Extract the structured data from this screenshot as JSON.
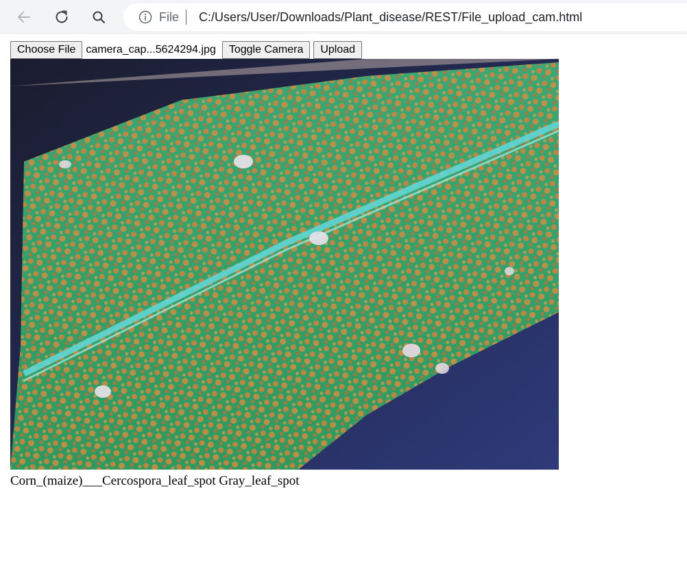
{
  "browser": {
    "icons": {
      "back": "arrow-left-icon",
      "reload": "reload-icon",
      "search": "search-icon",
      "info": "info-icon"
    },
    "address_bar": {
      "scheme_label": "File",
      "url": "C:/Users/User/Downloads/Plant_disease/REST/File_upload_cam.html"
    }
  },
  "upload_form": {
    "choose_file_label": "Choose File",
    "selected_file_name": "camera_cap...5624294.jpg",
    "toggle_camera_label": "Toggle Camera",
    "upload_label": "Upload"
  },
  "preview": {
    "subject": "Corn leaf with orange/brown leaf spots"
  },
  "result": {
    "prediction": "Corn_(maize)___Cercospora_leaf_spot Gray_leaf_spot"
  }
}
